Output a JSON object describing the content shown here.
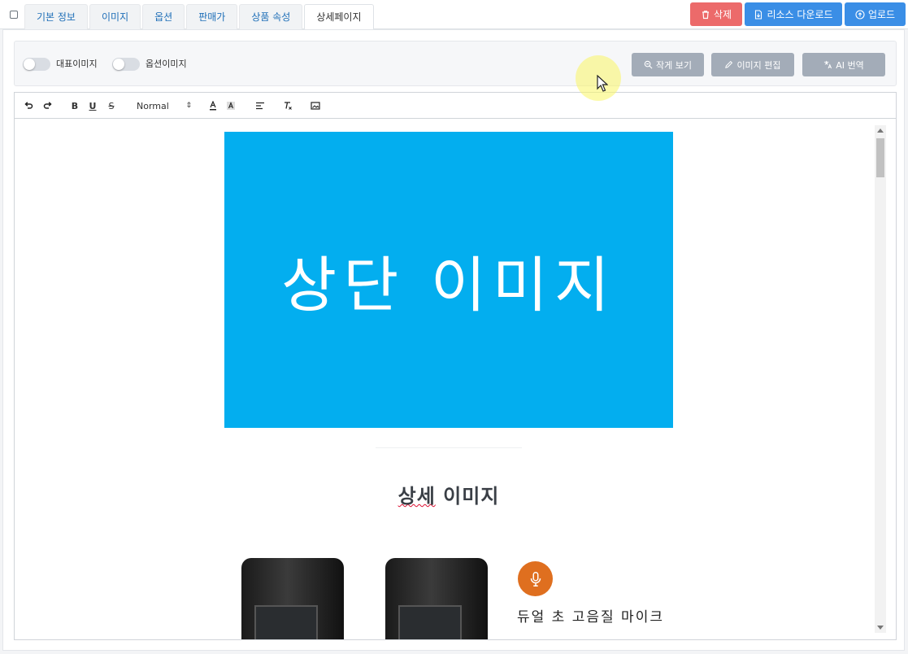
{
  "tabs": [
    "기본 정보",
    "이미지",
    "옵션",
    "판매가",
    "상품 속성",
    "상세페이지"
  ],
  "active_tab": "상세페이지",
  "top_buttons": {
    "delete": "삭제",
    "download_resources": "리소스 다운로드",
    "upload": "업로드"
  },
  "options": {
    "toggle_main_image": "대표이미지",
    "toggle_option_image": "옵션이미지",
    "zoom_out": "작게 보기",
    "edit_image": "이미지 편집",
    "ai_translate": "AI 번역"
  },
  "toolbar": {
    "bold": "B",
    "underline": "U",
    "strike": "S",
    "font_size": "Normal"
  },
  "content": {
    "hero_text": "상단 이미지",
    "detail_title_a": "상세",
    "detail_title_b": "이미지",
    "mic_text": "듀얼 초 고음질 마이크"
  },
  "colors": {
    "hero_bg": "#03aeef",
    "delete_btn": "#ec6a6a",
    "primary_btn": "#3a8ee6",
    "gray_btn": "#a3acb8",
    "mic_circle": "#df6f1f"
  },
  "icons": [
    "trash-icon",
    "file-download-icon",
    "cloud-upload-icon",
    "zoom-out-icon",
    "pencil-icon",
    "translate-icon",
    "undo-icon",
    "redo-icon",
    "align-icon",
    "clear-format-icon",
    "image-icon",
    "microphone-icon"
  ]
}
